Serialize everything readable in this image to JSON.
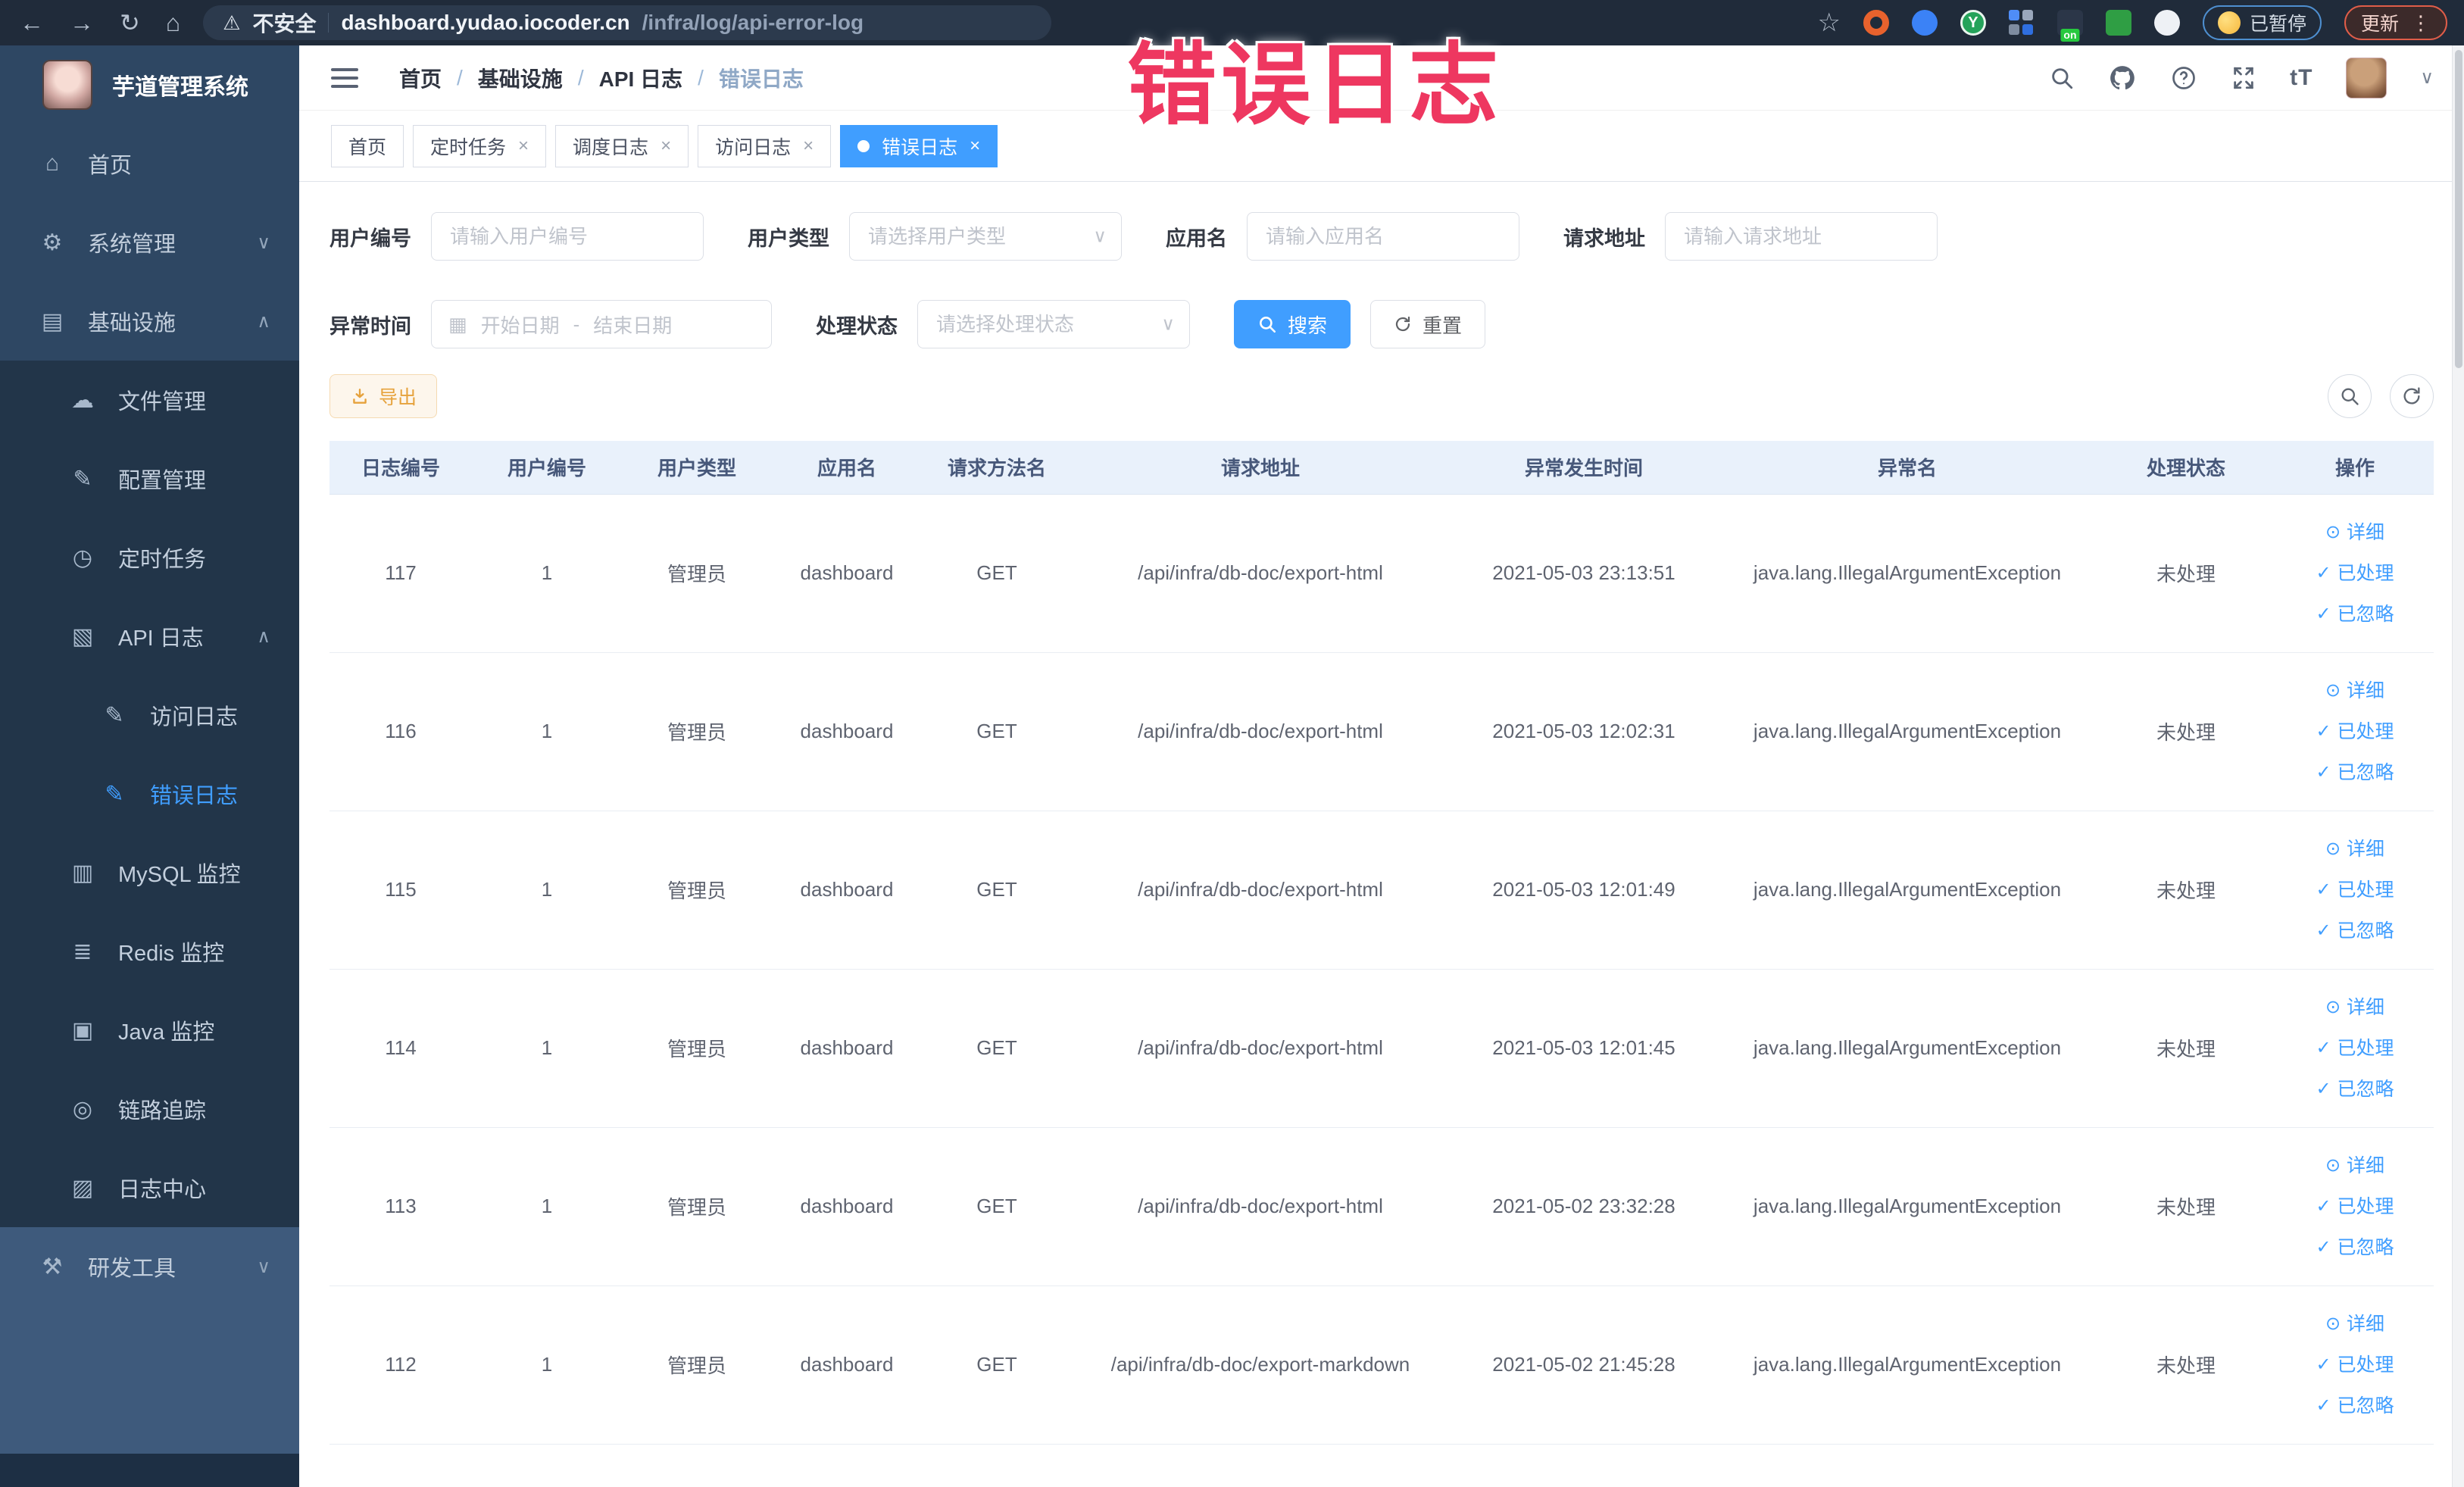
{
  "browser": {
    "security_label": "不安全",
    "url_host": "dashboard.yudao.iocoder.cn",
    "url_path": "/infra/log/api-error-log",
    "paused_badge": "已暂停",
    "update_button": "更新"
  },
  "glyphs": {
    "back": "←",
    "forward": "→",
    "reload": "↻",
    "home": "⌂",
    "warning": "⚠",
    "star": "☆",
    "dots": "⋮",
    "caret": "∨",
    "calendar": "▦",
    "close": "×",
    "font_size": "tT",
    "ext_y": "Y",
    "on_badge": "on"
  },
  "annotation": {
    "text": "错误日志",
    "color": "#ee3760"
  },
  "sidebar": {
    "logo_title": "芋道管理系统",
    "items": [
      {
        "icon": "⌂",
        "label": "首页"
      },
      {
        "icon": "⚙",
        "label": "系统管理",
        "chevron": "∨"
      },
      {
        "icon": "▤",
        "label": "基础设施",
        "chevron": "∧"
      },
      {
        "icon": "☁",
        "label": "文件管理"
      },
      {
        "icon": "✎",
        "label": "配置管理"
      },
      {
        "icon": "◷",
        "label": "定时任务"
      },
      {
        "icon": "▧",
        "label": "API 日志",
        "chevron": "∧"
      },
      {
        "icon": "✎",
        "label": "访问日志"
      },
      {
        "icon": "✎",
        "label": "错误日志"
      },
      {
        "icon": "▥",
        "label": "MySQL 监控"
      },
      {
        "icon": "≣",
        "label": "Redis 监控"
      },
      {
        "icon": "▣",
        "label": "Java 监控"
      },
      {
        "icon": "◎",
        "label": "链路追踪"
      },
      {
        "icon": "▨",
        "label": "日志中心"
      },
      {
        "icon": "⚒",
        "label": "研发工具",
        "chevron": "∨"
      }
    ]
  },
  "header": {
    "breadcrumb": [
      "首页",
      "基础设施",
      "API 日志",
      "错误日志"
    ],
    "separator": "/"
  },
  "tabs": [
    {
      "label": "首页"
    },
    {
      "label": "定时任务"
    },
    {
      "label": "调度日志"
    },
    {
      "label": "访问日志"
    },
    {
      "label": "错误日志"
    }
  ],
  "filters": {
    "user_id_label": "用户编号",
    "user_id_placeholder": "请输入用户编号",
    "user_type_label": "用户类型",
    "user_type_placeholder": "请选择用户类型",
    "app_label": "应用名",
    "app_placeholder": "请输入应用名",
    "url_label": "请求地址",
    "url_placeholder": "请输入请求地址",
    "time_label": "异常时间",
    "start_placeholder": "开始日期",
    "range_separator": "-",
    "end_placeholder": "结束日期",
    "status_label": "处理状态",
    "status_placeholder": "请选择处理状态",
    "search_label": "搜索",
    "reset_label": "重置"
  },
  "toolbar": {
    "export_label": "导出"
  },
  "table": {
    "columns": [
      "日志编号",
      "用户编号",
      "用户类型",
      "应用名",
      "请求方法名",
      "请求地址",
      "异常发生时间",
      "异常名",
      "处理状态",
      "操作"
    ],
    "action_icons": [
      "⊙",
      "✓",
      "✓"
    ],
    "row_actions": [
      "详细",
      "已处理",
      "已忽略"
    ],
    "rows": [
      {
        "log_id": "117",
        "user_id": "1",
        "user_type": "管理员",
        "app_name": "dashboard",
        "method": "GET",
        "url": "/api/infra/db-doc/export-html",
        "time": "2021-05-03 23:13:51",
        "exception": "java.lang.IllegalArgumentException",
        "status": "未处理"
      },
      {
        "log_id": "116",
        "user_id": "1",
        "user_type": "管理员",
        "app_name": "dashboard",
        "method": "GET",
        "url": "/api/infra/db-doc/export-html",
        "time": "2021-05-03 12:02:31",
        "exception": "java.lang.IllegalArgumentException",
        "status": "未处理"
      },
      {
        "log_id": "115",
        "user_id": "1",
        "user_type": "管理员",
        "app_name": "dashboard",
        "method": "GET",
        "url": "/api/infra/db-doc/export-html",
        "time": "2021-05-03 12:01:49",
        "exception": "java.lang.IllegalArgumentException",
        "status": "未处理"
      },
      {
        "log_id": "114",
        "user_id": "1",
        "user_type": "管理员",
        "app_name": "dashboard",
        "method": "GET",
        "url": "/api/infra/db-doc/export-html",
        "time": "2021-05-03 12:01:45",
        "exception": "java.lang.IllegalArgumentException",
        "status": "未处理"
      },
      {
        "log_id": "113",
        "user_id": "1",
        "user_type": "管理员",
        "app_name": "dashboard",
        "method": "GET",
        "url": "/api/infra/db-doc/export-html",
        "time": "2021-05-02 23:32:28",
        "exception": "java.lang.IllegalArgumentException",
        "status": "未处理"
      },
      {
        "log_id": "112",
        "user_id": "1",
        "user_type": "管理员",
        "app_name": "dashboard",
        "method": "GET",
        "url": "/api/infra/db-doc/export-markdown",
        "time": "2021-05-02 21:45:28",
        "exception": "java.lang.IllegalArgumentException",
        "status": "未处理"
      }
    ]
  },
  "colors": {
    "accent": "#409eff",
    "table_header_bg": "#e9f1fb",
    "sidebar_bg": "#2e4763",
    "submenu_bg": "#223549"
  }
}
